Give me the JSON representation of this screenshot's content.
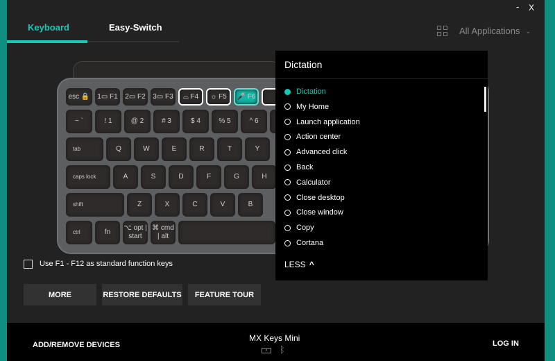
{
  "window": {
    "minimize": "-",
    "close": "X"
  },
  "tabs": [
    {
      "label": "Keyboard",
      "active": true
    },
    {
      "label": "Easy-Switch",
      "active": false
    }
  ],
  "app_selector": {
    "label": "All Applications",
    "icon": "grid-icon"
  },
  "colors": {
    "accent": "#17c8b5",
    "background": "#222223"
  },
  "keyboard": {
    "rows": [
      [
        {
          "t": "esc 🔒"
        },
        {
          "t": "1▭ F1"
        },
        {
          "t": "2▭ F2"
        },
        {
          "t": "3▭ F3"
        },
        {
          "t": "⌓ F4",
          "state": "outlined"
        },
        {
          "t": "☼ F5",
          "state": "outlined"
        },
        {
          "t": "🎤 F6",
          "state": "active"
        },
        {
          "t": "",
          "state": "outlined"
        }
      ],
      [
        {
          "t": "~ `"
        },
        {
          "t": "! 1"
        },
        {
          "t": "@ 2"
        },
        {
          "t": "# 3"
        },
        {
          "t": "$ 4"
        },
        {
          "t": "% 5"
        },
        {
          "t": "^ 6"
        },
        {
          "t": ""
        }
      ],
      [
        {
          "t": "tab"
        },
        {
          "t": "Q"
        },
        {
          "t": "W"
        },
        {
          "t": "E"
        },
        {
          "t": "R"
        },
        {
          "t": "T"
        },
        {
          "t": "Y"
        }
      ],
      [
        {
          "t": "caps lock"
        },
        {
          "t": "A"
        },
        {
          "t": "S"
        },
        {
          "t": "D"
        },
        {
          "t": "F"
        },
        {
          "t": "G"
        },
        {
          "t": "H"
        }
      ],
      [
        {
          "t": "shift"
        },
        {
          "t": "Z"
        },
        {
          "t": "X"
        },
        {
          "t": "C"
        },
        {
          "t": "V"
        },
        {
          "t": "B"
        }
      ],
      [
        {
          "t": "ctrl"
        },
        {
          "t": "fn"
        },
        {
          "t": "⌥ opt | start"
        },
        {
          "t": "⌘ cmd | alt"
        },
        {
          "t": ""
        }
      ]
    ]
  },
  "popup": {
    "title": "Dictation",
    "items": [
      {
        "label": "Dictation",
        "selected": true
      },
      {
        "label": "My Home"
      },
      {
        "label": "Launch application"
      },
      {
        "label": "Action center"
      },
      {
        "label": "Advanced click"
      },
      {
        "label": "Back"
      },
      {
        "label": "Calculator"
      },
      {
        "label": "Close desktop"
      },
      {
        "label": "Close window"
      },
      {
        "label": "Copy"
      },
      {
        "label": "Cortana"
      }
    ],
    "less": "LESS"
  },
  "checkbox": {
    "label": "Use F1 - F12 as standard function keys",
    "checked": false
  },
  "buttons": {
    "more": "MORE",
    "restore": "RESTORE DEFAULTS",
    "tour": "FEATURE TOUR"
  },
  "footer": {
    "add_remove": "ADD/REMOVE DEVICES",
    "device": "MX Keys Mini",
    "battery_icon": "battery-icon",
    "bt_icon": "bluetooth-icon",
    "login": "LOG IN"
  }
}
